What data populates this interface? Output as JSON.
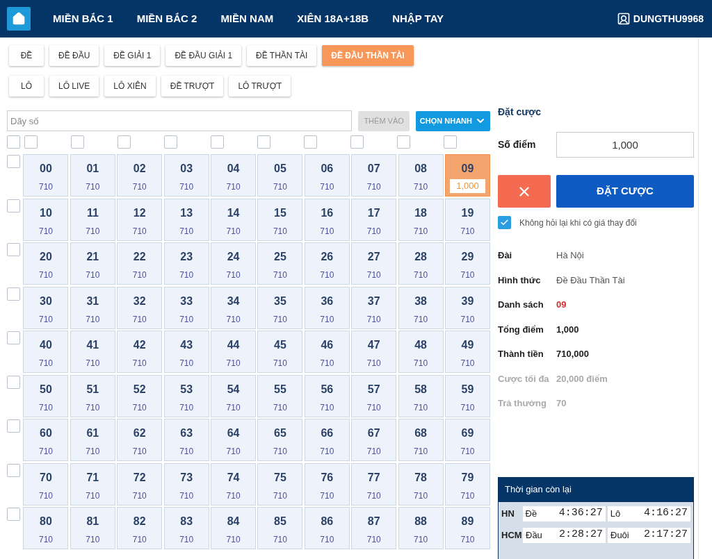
{
  "nav": {
    "items": [
      {
        "label": "MIỀN BẮC 1",
        "selected": false
      },
      {
        "label": "MIỀN BẮC 2",
        "selected": false
      },
      {
        "label": "MIỀN NAM",
        "selected": false
      },
      {
        "label": "XIÊN 18A+18B",
        "selected": false
      },
      {
        "label": "NHẬP TAY",
        "selected": false
      }
    ],
    "user": "DUNGTHU9968"
  },
  "bet_types": [
    [
      {
        "label": "ĐỀ",
        "selected": false
      },
      {
        "label": "ĐỀ ĐẦU",
        "selected": false
      },
      {
        "label": "ĐỀ GIẢI 1",
        "selected": false
      },
      {
        "label": "ĐỀ ĐẦU GIẢI 1",
        "selected": false
      },
      {
        "label": "ĐỀ THẦN TÀI",
        "selected": false
      },
      {
        "label": "ĐỀ ĐẦU THẦN TÀI",
        "selected": true
      }
    ],
    [
      {
        "label": "LÔ",
        "selected": false
      },
      {
        "label": "LÔ LIVE",
        "selected": false
      },
      {
        "label": "LÔ XIÊN",
        "selected": false
      },
      {
        "label": "ĐỀ TRƯỢT",
        "selected": false
      },
      {
        "label": "LÔ TRƯỢT",
        "selected": false
      }
    ]
  ],
  "number_input": {
    "placeholder": "Dãy số",
    "add_button": "THÊM VÀO",
    "add_disabled": true,
    "quick_button": "CHỌN NHANH"
  },
  "select_all": {
    "checked": false
  },
  "column_checks": [
    {
      "checked": false
    },
    {
      "checked": false
    },
    {
      "checked": false
    },
    {
      "checked": false
    },
    {
      "checked": false
    },
    {
      "checked": false
    },
    {
      "checked": false
    },
    {
      "checked": false
    },
    {
      "checked": false
    },
    {
      "checked": false
    }
  ],
  "rows": [
    {
      "checked": false,
      "cells": [
        {
          "number": "00",
          "odds": "710",
          "selected": false
        },
        {
          "number": "01",
          "odds": "710",
          "selected": false
        },
        {
          "number": "02",
          "odds": "710",
          "selected": false
        },
        {
          "number": "03",
          "odds": "710",
          "selected": false
        },
        {
          "number": "04",
          "odds": "710",
          "selected": false
        },
        {
          "number": "05",
          "odds": "710",
          "selected": false
        },
        {
          "number": "06",
          "odds": "710",
          "selected": false
        },
        {
          "number": "07",
          "odds": "710",
          "selected": false
        },
        {
          "number": "08",
          "odds": "710",
          "selected": false
        },
        {
          "number": "09",
          "amount": "1,000",
          "selected": true
        }
      ]
    },
    {
      "checked": false,
      "cells": [
        {
          "number": "10",
          "odds": "710",
          "selected": false
        },
        {
          "number": "11",
          "odds": "710",
          "selected": false
        },
        {
          "number": "12",
          "odds": "710",
          "selected": false
        },
        {
          "number": "13",
          "odds": "710",
          "selected": false
        },
        {
          "number": "14",
          "odds": "710",
          "selected": false
        },
        {
          "number": "15",
          "odds": "710",
          "selected": false
        },
        {
          "number": "16",
          "odds": "710",
          "selected": false
        },
        {
          "number": "17",
          "odds": "710",
          "selected": false
        },
        {
          "number": "18",
          "odds": "710",
          "selected": false
        },
        {
          "number": "19",
          "odds": "710",
          "selected": false
        }
      ]
    },
    {
      "checked": false,
      "cells": [
        {
          "number": "20",
          "odds": "710",
          "selected": false
        },
        {
          "number": "21",
          "odds": "710",
          "selected": false
        },
        {
          "number": "22",
          "odds": "710",
          "selected": false
        },
        {
          "number": "23",
          "odds": "710",
          "selected": false
        },
        {
          "number": "24",
          "odds": "710",
          "selected": false
        },
        {
          "number": "25",
          "odds": "710",
          "selected": false
        },
        {
          "number": "26",
          "odds": "710",
          "selected": false
        },
        {
          "number": "27",
          "odds": "710",
          "selected": false
        },
        {
          "number": "28",
          "odds": "710",
          "selected": false
        },
        {
          "number": "29",
          "odds": "710",
          "selected": false
        }
      ]
    },
    {
      "checked": false,
      "cells": [
        {
          "number": "30",
          "odds": "710",
          "selected": false
        },
        {
          "number": "31",
          "odds": "710",
          "selected": false
        },
        {
          "number": "32",
          "odds": "710",
          "selected": false
        },
        {
          "number": "33",
          "odds": "710",
          "selected": false
        },
        {
          "number": "34",
          "odds": "710",
          "selected": false
        },
        {
          "number": "35",
          "odds": "710",
          "selected": false
        },
        {
          "number": "36",
          "odds": "710",
          "selected": false
        },
        {
          "number": "37",
          "odds": "710",
          "selected": false
        },
        {
          "number": "38",
          "odds": "710",
          "selected": false
        },
        {
          "number": "39",
          "odds": "710",
          "selected": false
        }
      ]
    },
    {
      "checked": false,
      "cells": [
        {
          "number": "40",
          "odds": "710",
          "selected": false
        },
        {
          "number": "41",
          "odds": "710",
          "selected": false
        },
        {
          "number": "42",
          "odds": "710",
          "selected": false
        },
        {
          "number": "43",
          "odds": "710",
          "selected": false
        },
        {
          "number": "44",
          "odds": "710",
          "selected": false
        },
        {
          "number": "45",
          "odds": "710",
          "selected": false
        },
        {
          "number": "46",
          "odds": "710",
          "selected": false
        },
        {
          "number": "47",
          "odds": "710",
          "selected": false
        },
        {
          "number": "48",
          "odds": "710",
          "selected": false
        },
        {
          "number": "49",
          "odds": "710",
          "selected": false
        }
      ]
    },
    {
      "checked": false,
      "cells": [
        {
          "number": "50",
          "odds": "710",
          "selected": false
        },
        {
          "number": "51",
          "odds": "710",
          "selected": false
        },
        {
          "number": "52",
          "odds": "710",
          "selected": false
        },
        {
          "number": "53",
          "odds": "710",
          "selected": false
        },
        {
          "number": "54",
          "odds": "710",
          "selected": false
        },
        {
          "number": "55",
          "odds": "710",
          "selected": false
        },
        {
          "number": "56",
          "odds": "710",
          "selected": false
        },
        {
          "number": "57",
          "odds": "710",
          "selected": false
        },
        {
          "number": "58",
          "odds": "710",
          "selected": false
        },
        {
          "number": "59",
          "odds": "710",
          "selected": false
        }
      ]
    },
    {
      "checked": false,
      "cells": [
        {
          "number": "60",
          "odds": "710",
          "selected": false
        },
        {
          "number": "61",
          "odds": "710",
          "selected": false
        },
        {
          "number": "62",
          "odds": "710",
          "selected": false
        },
        {
          "number": "63",
          "odds": "710",
          "selected": false
        },
        {
          "number": "64",
          "odds": "710",
          "selected": false
        },
        {
          "number": "65",
          "odds": "710",
          "selected": false
        },
        {
          "number": "66",
          "odds": "710",
          "selected": false
        },
        {
          "number": "67",
          "odds": "710",
          "selected": false
        },
        {
          "number": "68",
          "odds": "710",
          "selected": false
        },
        {
          "number": "69",
          "odds": "710",
          "selected": false
        }
      ]
    },
    {
      "checked": false,
      "cells": [
        {
          "number": "70",
          "odds": "710",
          "selected": false
        },
        {
          "number": "71",
          "odds": "710",
          "selected": false
        },
        {
          "number": "72",
          "odds": "710",
          "selected": false
        },
        {
          "number": "73",
          "odds": "710",
          "selected": false
        },
        {
          "number": "74",
          "odds": "710",
          "selected": false
        },
        {
          "number": "75",
          "odds": "710",
          "selected": false
        },
        {
          "number": "76",
          "odds": "710",
          "selected": false
        },
        {
          "number": "77",
          "odds": "710",
          "selected": false
        },
        {
          "number": "78",
          "odds": "710",
          "selected": false
        },
        {
          "number": "79",
          "odds": "710",
          "selected": false
        }
      ]
    },
    {
      "checked": false,
      "cells": [
        {
          "number": "80",
          "odds": "710",
          "selected": false
        },
        {
          "number": "81",
          "odds": "710",
          "selected": false
        },
        {
          "number": "82",
          "odds": "710",
          "selected": false
        },
        {
          "number": "83",
          "odds": "710",
          "selected": false
        },
        {
          "number": "84",
          "odds": "710",
          "selected": false
        },
        {
          "number": "85",
          "odds": "710",
          "selected": false
        },
        {
          "number": "86",
          "odds": "710",
          "selected": false
        },
        {
          "number": "87",
          "odds": "710",
          "selected": false
        },
        {
          "number": "88",
          "odds": "710",
          "selected": false
        },
        {
          "number": "89",
          "odds": "710",
          "selected": false
        }
      ]
    }
  ],
  "bet_panel": {
    "title": "Đặt cược",
    "points_label": "Số điểm",
    "points_value": "1,000",
    "submit_button": "ĐẶT CƯỢC",
    "no_ask": {
      "label": "Không hỏi lại khi có giá thay đổi",
      "checked": true
    },
    "summary": [
      {
        "label": "Đài",
        "value": "Hà Nội",
        "kind": "plain"
      },
      {
        "label": "Hình thức",
        "value": "Đề Đầu Thần Tài",
        "kind": "plain"
      },
      {
        "label": "Danh sách",
        "value": "09",
        "kind": "highlight"
      },
      {
        "label": "Tổng điểm",
        "value": "1,000",
        "kind": "strong"
      },
      {
        "label": "Thành tiền",
        "value": "710,000",
        "kind": "strong"
      },
      {
        "label": "Cược tối đa",
        "value": "20,000 điểm",
        "kind": "muted"
      },
      {
        "label": "Trả thưởng",
        "value": "70",
        "kind": "muted"
      }
    ]
  },
  "timer": {
    "title": "Thời gian còn lại",
    "rows": [
      {
        "station": "HN",
        "items": [
          {
            "label": "Đề",
            "time": "4:36:27"
          },
          {
            "label": "Lô",
            "time": "4:16:27"
          }
        ]
      },
      {
        "station": "HCM",
        "items": [
          {
            "label": "Đầu",
            "time": "2:28:27"
          },
          {
            "label": "Đuôi",
            "time": "2:17:27"
          }
        ]
      }
    ]
  }
}
